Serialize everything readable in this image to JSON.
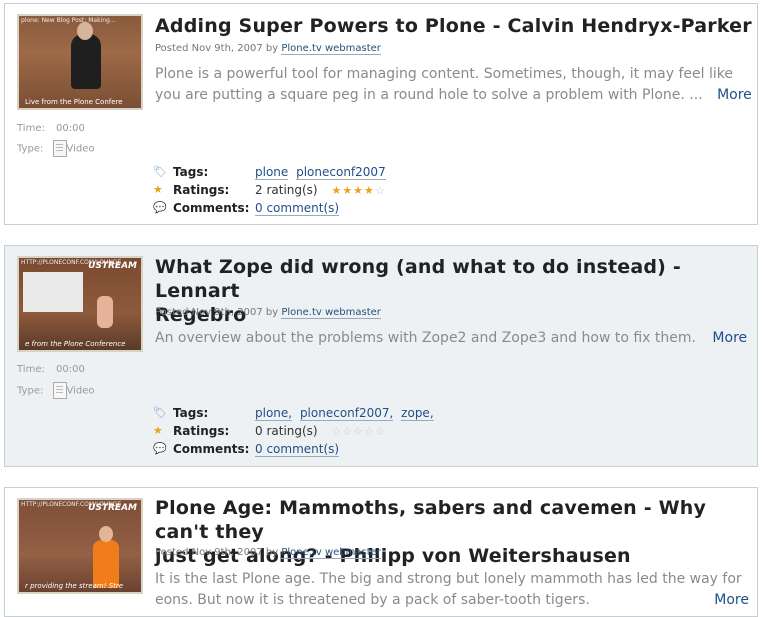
{
  "posts": [
    {
      "title": "Adding Super Powers to Plone - Calvin Hendryx-Parker",
      "posted_prefix": "Posted Nov 9th, 2007 by",
      "author": "Plone.tv webmaster",
      "desc_line1": "Plone is a powerful tool for managing content. Sometimes, though, it may feel like",
      "desc_line2": "you are putting a square peg in a round hole to solve a problem with Plone. ...",
      "more": "More",
      "thumb_url": "plone: New Blog Post: Making...",
      "thumb_caption": "Live from the Plone Confere",
      "time_label": "Time:",
      "time_value": "00:00",
      "type_label": "Type:",
      "type_value": "Video",
      "tags_label": "Tags:",
      "tags": [
        "plone",
        "ploneconf2007"
      ],
      "ratings_label": "Ratings:",
      "ratings_text": "2 rating(s)",
      "rating_stars": 4,
      "comments_label": "Comments:",
      "comments_text": "0 comment(s)"
    },
    {
      "title_line1": "What Zope did wrong (and what to do instead) - Lennart",
      "title_line2": "Regebro",
      "posted_prefix": "Posted Nov 9th, 2007 by",
      "author": "Plone.tv webmaster",
      "desc_line1": "An overview about the problems with Zope2 and Zope3 and how to fix them.",
      "more": "More",
      "thumb_url": "HTTP://PLONECONF.COM/LOUNGE",
      "thumb_logo": "USTREAM",
      "thumb_caption": "e from the Plone Conference",
      "time_label": "Time:",
      "time_value": "00:00",
      "type_label": "Type:",
      "type_value": "Video",
      "tags_label": "Tags:",
      "tags": [
        "plone,",
        "ploneconf2007,",
        "zope,"
      ],
      "ratings_label": "Ratings:",
      "ratings_text": "0 rating(s)",
      "rating_stars": 0,
      "comments_label": "Comments:",
      "comments_text": "0 comment(s)"
    },
    {
      "title_line1": "Plone Age: Mammoths, sabers and cavemen - Why can't they",
      "title_line2": "just get along? - Philipp von Weitershausen",
      "posted_prefix": "Posted Nov 9th, 2007 by",
      "author": "Plone.tv webmaster",
      "desc_line1": "It is the last Plone age. The big and strong but lonely mammoth has led the way for",
      "desc_line2": "eons. But now it is threatened by a pack of saber-tooth tigers.",
      "more": "More",
      "thumb_url": "HTTP://PLONECONF.COM/LOUNGE",
      "thumb_logo": "USTREAM",
      "thumb_caption": "r providing the stream! Stre"
    }
  ]
}
